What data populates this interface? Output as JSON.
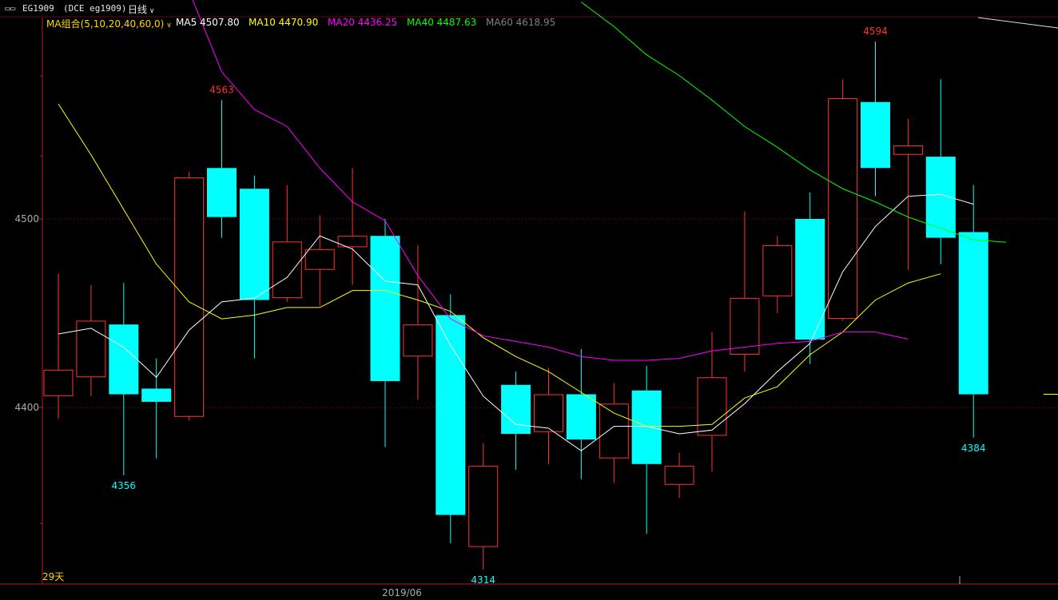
{
  "header": {
    "symbol": "EG1909",
    "contract": "(DCE eg1909)",
    "period": "日线",
    "period_chevron": "chevron-down-icon"
  },
  "legend": {
    "group_label": "MA组合(5,10,20,40,60,0)",
    "items": [
      {
        "label": "MA5 4507.80",
        "color": "#ffffff"
      },
      {
        "label": "MA10 4470.90",
        "color": "#ffff00"
      },
      {
        "label": "MA20 4436.25",
        "color": "#ff00ff"
      },
      {
        "label": "MA40 4487.63",
        "color": "#00ff00"
      },
      {
        "label": "MA60 4618.95",
        "color": "#808080"
      }
    ],
    "group_color": "#ffd700"
  },
  "footer": {
    "days_label": "29天",
    "date_label": "2019/06"
  },
  "chart_data": {
    "type": "candlestick",
    "ylim": [
      4298,
      4620
    ],
    "yticks": [
      4400,
      4500
    ],
    "grid": true,
    "up_color": "#ff3232",
    "down_color": "#00ffff",
    "candles": [
      {
        "open": 4406,
        "high": 4471,
        "low": 4394,
        "close": 4420
      },
      {
        "open": 4416,
        "high": 4465,
        "low": 4406,
        "close": 4446
      },
      {
        "open": 4444,
        "high": 4466,
        "low": 4364,
        "close": 4407
      },
      {
        "open": 4410,
        "high": 4426,
        "low": 4373,
        "close": 4403
      },
      {
        "open": 4395,
        "high": 4525,
        "low": 4393,
        "close": 4522
      },
      {
        "open": 4527,
        "high": 4563,
        "low": 4490,
        "close": 4501
      },
      {
        "open": 4516,
        "high": 4523,
        "low": 4426,
        "close": 4457
      },
      {
        "open": 4458,
        "high": 4518,
        "low": 4456,
        "close": 4488
      },
      {
        "open": 4473,
        "high": 4502,
        "low": 4454,
        "close": 4484
      },
      {
        "open": 4485,
        "high": 4527,
        "low": 4465,
        "close": 4491
      },
      {
        "open": 4491,
        "high": 4500,
        "low": 4379,
        "close": 4414
      },
      {
        "open": 4427,
        "high": 4486,
        "low": 4404,
        "close": 4444
      },
      {
        "open": 4449,
        "high": 4460,
        "low": 4328,
        "close": 4343
      },
      {
        "open": 4326,
        "high": 4381,
        "low": 4314,
        "close": 4369
      },
      {
        "open": 4412,
        "high": 4419,
        "low": 4367,
        "close": 4386
      },
      {
        "open": 4387,
        "high": 4421,
        "low": 4370,
        "close": 4407
      },
      {
        "open": 4407,
        "high": 4431,
        "low": 4362,
        "close": 4383
      },
      {
        "open": 4373,
        "high": 4413,
        "low": 4360,
        "close": 4402
      },
      {
        "open": 4409,
        "high": 4422,
        "low": 4333,
        "close": 4370
      },
      {
        "open": 4359,
        "high": 4376,
        "low": 4352,
        "close": 4369
      },
      {
        "open": 4385,
        "high": 4440,
        "low": 4366,
        "close": 4416
      },
      {
        "open": 4428,
        "high": 4504,
        "low": 4419,
        "close": 4458
      },
      {
        "open": 4459,
        "high": 4491,
        "low": 4450,
        "close": 4486
      },
      {
        "open": 4500,
        "high": 4514,
        "low": 4423,
        "close": 4436
      },
      {
        "open": 4447,
        "high": 4574,
        "low": 4446,
        "close": 4564
      },
      {
        "open": 4562,
        "high": 4594,
        "low": 4512,
        "close": 4527
      },
      {
        "open": 4534,
        "high": 4553,
        "low": 4473,
        "close": 4539
      },
      {
        "open": 4533,
        "high": 4574,
        "low": 4476,
        "close": 4490
      },
      {
        "open": 4493,
        "high": 4518,
        "low": 4384,
        "close": 4407
      }
    ],
    "series": [
      {
        "name": "MA5",
        "color": "#ffffff",
        "values": [
          4439,
          4442,
          4432,
          4416,
          4441,
          4456,
          4458,
          4469,
          4491,
          4484,
          4467,
          4465,
          4433,
          4406,
          4391,
          4389,
          4377,
          4390,
          4390,
          4386,
          4388,
          4402,
          4419,
          4434,
          4472,
          4496,
          4512,
          4513,
          4507.8
        ]
      },
      {
        "name": "MA10",
        "color": "#ffff00",
        "values": [
          4561,
          4534,
          4505,
          4476,
          4456,
          4447,
          4449,
          4453,
          4453,
          4462,
          4462,
          4457,
          4451,
          4437,
          4427,
          4419,
          4408,
          4397,
          4390,
          4390,
          4391,
          4405,
          4411,
          4428,
          4440,
          4457,
          4466,
          4470.9
        ]
      },
      {
        "name": "MA20",
        "color": "#ff00ff",
        "values": [
          4621,
          4578,
          4558,
          4549,
          4527,
          4509,
          4499,
          4470,
          4447,
          4438,
          4435,
          4432,
          4427,
          4425,
          4425,
          4426,
          4430,
          4432,
          4434,
          4435,
          4440,
          4440,
          4436.25
        ]
      },
      {
        "name": "MA40",
        "color": "#00ff00",
        "values": [
          4615,
          4602,
          4587,
          4576,
          4563,
          4549,
          4538,
          4526,
          4516,
          4509,
          4501,
          4495,
          4489,
          4487.63
        ]
      },
      {
        "name": "MA60",
        "color": "#808080",
        "values": []
      }
    ],
    "ma_start_index": {
      "MA5": 0,
      "MA10": 0,
      "MA20": 4,
      "MA40": 16
    },
    "annotations": [
      {
        "candle": 2,
        "label": "4356",
        "position": "below",
        "color": "#00ffff"
      },
      {
        "candle": 5,
        "label": "4563",
        "position": "above",
        "color": "#ff3232"
      },
      {
        "candle": 13,
        "label": "4314",
        "position": "below",
        "color": "#00ffff"
      },
      {
        "candle": 25,
        "label": "4594",
        "position": "above",
        "color": "#ff3232"
      },
      {
        "candle": 28,
        "label": "4384",
        "position": "below",
        "color": "#00ffff"
      }
    ],
    "ytick_labels": [
      "4400",
      "4500"
    ]
  }
}
